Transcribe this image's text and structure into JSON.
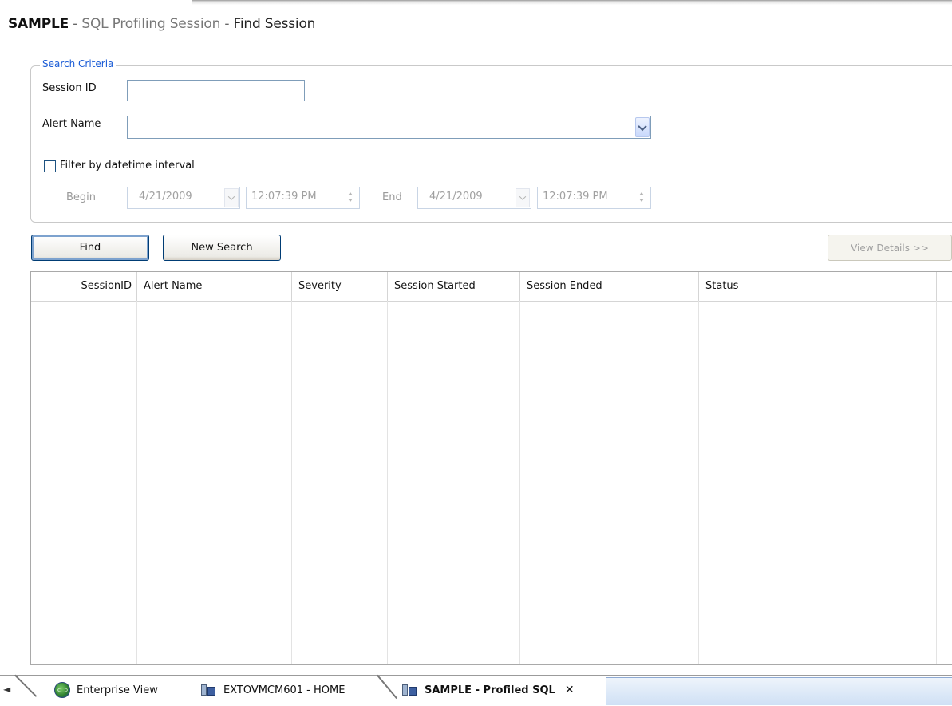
{
  "title": {
    "part1": "SAMPLE",
    "sep1": " - ",
    "part2": "SQL Profiling Session",
    "sep2": " - ",
    "part3": "Find Session"
  },
  "search": {
    "legend": "Search Criteria",
    "session_id_label": "Session ID",
    "session_id_value": "",
    "alert_name_label": "Alert Name",
    "alert_name_value": "",
    "filter_label": "Filter by datetime interval",
    "filter_checked": false,
    "begin_label": "Begin",
    "begin_date": "4/21/2009",
    "begin_time": "12:07:39 PM",
    "end_label": "End",
    "end_date": "4/21/2009",
    "end_time": "12:07:39 PM"
  },
  "buttons": {
    "find": "Find",
    "new_search": "New Search",
    "view_details": "View Details >>"
  },
  "grid": {
    "columns": [
      "SessionID",
      "Alert Name",
      "Severity",
      "Session Started",
      "Session Ended",
      "Status"
    ],
    "rows": []
  },
  "tabs": {
    "scroll_left": "◄",
    "items": [
      {
        "label": "Enterprise View",
        "icon": "globe-icon"
      },
      {
        "label": "EXTOVMCM601 - HOME",
        "icon": "server-icon"
      },
      {
        "label": "SAMPLE - Profiled SQL",
        "icon": "server-icon",
        "active": true
      }
    ],
    "close_glyph": "✕"
  }
}
